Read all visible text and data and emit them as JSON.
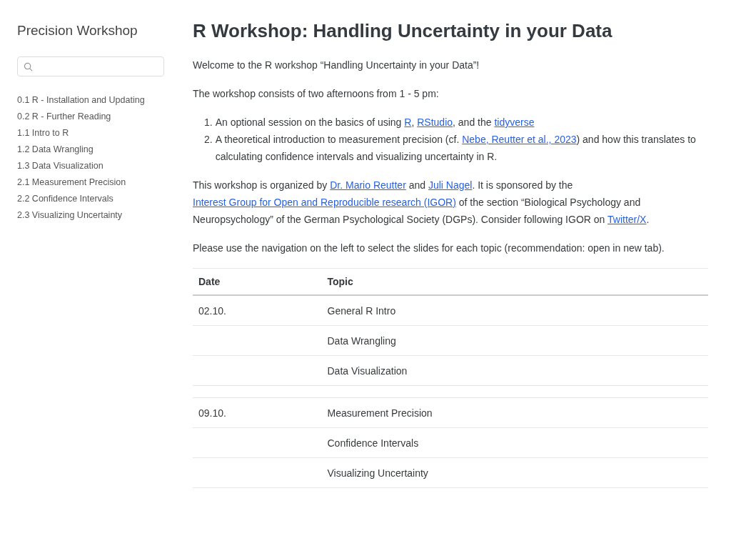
{
  "sidebar": {
    "title": "Precision Workshop",
    "items": [
      {
        "label": "0.1 R - Installation and Updating"
      },
      {
        "label": "0.2 R - Further Reading"
      },
      {
        "label": "1.1 Intro to R"
      },
      {
        "label": "1.2 Data Wrangling"
      },
      {
        "label": "1.3 Data Visualization"
      },
      {
        "label": "2.1 Measurement Precision"
      },
      {
        "label": "2.2 Confidence Intervals"
      },
      {
        "label": "2.3 Visualizing Uncertainty"
      }
    ]
  },
  "main": {
    "title": "R Workshop: Handling Uncertainty in your Data",
    "blocks": [
      {
        "kind": "paragraph",
        "parts": [
          {
            "kind": "text",
            "text": "Welcome to the R workshop “Handling Uncertainty in your Data”!"
          }
        ]
      },
      {
        "kind": "paragraph",
        "parts": [
          {
            "kind": "text",
            "text": "The workshop consists of two afternoons from 1 - 5 pm:"
          }
        ]
      },
      {
        "kind": "list",
        "items": [
          {
            "number": "1.",
            "parts": [
              {
                "kind": "text",
                "text": "An optional session on the basics of using "
              },
              {
                "kind": "link",
                "text": "R"
              },
              {
                "kind": "text",
                "text": ", "
              },
              {
                "kind": "link",
                "text": "RStudio"
              },
              {
                "kind": "text",
                "text": ", and the "
              },
              {
                "kind": "link",
                "text": "tidyverse"
              }
            ]
          },
          {
            "number": "2.",
            "parts": [
              {
                "kind": "text",
                "text": "A theoretical introduction to measurement precision (cf. "
              },
              {
                "kind": "link",
                "text": "Nebe, Reutter et al., 2023"
              },
              {
                "kind": "text",
                "text": ") and how this translates to calculating confidence intervals and visualizing uncertainty in R."
              }
            ]
          }
        ]
      },
      {
        "kind": "paragraph",
        "parts": [
          {
            "kind": "text",
            "text": "This workshop is organized by "
          },
          {
            "kind": "link",
            "text": "Dr. Mario Reutter"
          },
          {
            "kind": "text",
            "text": " and "
          },
          {
            "kind": "link",
            "text": "Juli Nagel"
          },
          {
            "kind": "text",
            "text": ". It is sponsored by the "
          },
          {
            "kind": "link",
            "text": "Interest Group for Open and Reproducible research (IGOR)"
          },
          {
            "kind": "text",
            "text": " of the section “Biological Psychology and Neuropsychology” of the German Psychological Society (DGPs). Consider following IGOR on "
          },
          {
            "kind": "link",
            "text": "Twitter/X"
          },
          {
            "kind": "text",
            "text": "."
          }
        ]
      },
      {
        "kind": "paragraph",
        "parts": [
          {
            "kind": "text",
            "text": "Please use the navigation on the left to select the slides for each topic (recommendation: open in new tab)."
          }
        ]
      }
    ],
    "table": {
      "columns": [
        "Date",
        "Topic"
      ],
      "sessions": [
        {
          "date": "02.10.",
          "topics": [
            "General R Intro",
            "Data Wrangling",
            "Data Visualization"
          ]
        },
        {
          "date": "09.10.",
          "topics": [
            "Measurement Precision",
            "Confidence Intervals",
            "Visualizing Uncertainty"
          ]
        }
      ]
    }
  }
}
